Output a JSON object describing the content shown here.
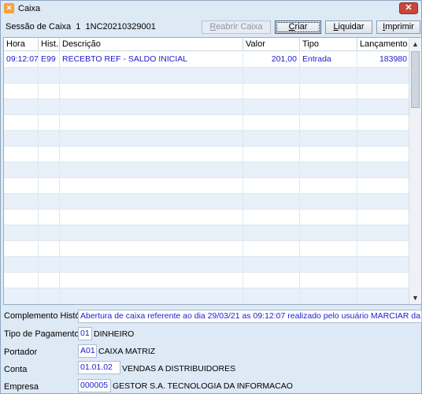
{
  "window": {
    "title": "Caixa",
    "close_glyph": "✕",
    "app_icon_glyph": "✕"
  },
  "session": {
    "label": "Sessão de Caixa",
    "number": "1",
    "code": "1NC20210329001"
  },
  "buttons": {
    "reabrir": "Reabrir Caixa",
    "criar": "Criar",
    "liquidar": "Liquidar",
    "imprimir": "Imprimir"
  },
  "table": {
    "columns": [
      "Hora",
      "Hist.",
      "Descrição",
      "Valor",
      "Tipo",
      "Lançamento"
    ],
    "rows": [
      {
        "hora": "09:12:07",
        "hist": "E99",
        "descricao": "RECEBTO REF - SALDO INICIAL",
        "valor": "201,00",
        "tipo": "Entrada",
        "lancamento": "183980"
      }
    ]
  },
  "scrollbar": {
    "up_icon": "▲",
    "down_icon": "▼"
  },
  "fields": {
    "complemento": {
      "label": "Complemento Histórico",
      "value": "Abertura de caixa referente ao dia  29/03/21  as  09:12:07  realizado pelo usuário  MARCIAR  da Unidade de"
    },
    "tipo_pagamento": {
      "label": "Tipo de Pagamento",
      "code": "01",
      "desc": "DINHEIRO"
    },
    "portador": {
      "label": "Portador",
      "code": "A01",
      "desc": "CAIXA MATRIZ"
    },
    "conta": {
      "label": "Conta",
      "code": "01.01.02",
      "desc": "VENDAS A DISTRIBUIDORES"
    },
    "empresa": {
      "label": "Empresa",
      "code": "000005",
      "desc": "GESTOR S.A. TECNOLOGIA DA INFORMACAO"
    }
  }
}
